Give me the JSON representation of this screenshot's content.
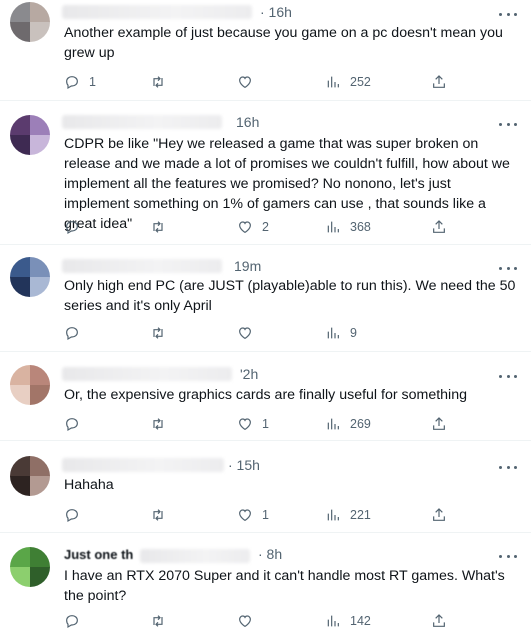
{
  "replies": [
    {
      "time": "· 16h",
      "text": "Another example of just because you game on a pc doesn't mean you grew up",
      "reply_count": "1",
      "retweet_count": "",
      "like_count": "",
      "view_count": "252",
      "avatar_colors": [
        "#8a8a8e",
        "#b7a9a2",
        "#6e6a6d",
        "#c9c1bd"
      ]
    },
    {
      "time": "16h",
      "text": "CDPR be like \"Hey we released a game that was super broken on release and we made a lot of promises we couldn't fulfill, how about we implement all the features we promised? No nonono, let's just implement something on 1% of gamers can use , that sounds like a great idea\"",
      "reply_count": "",
      "retweet_count": "",
      "like_count": "2",
      "view_count": "368",
      "avatar_colors": [
        "#5b3b6e",
        "#9c7fb8",
        "#3e2a52",
        "#c8b6da"
      ]
    },
    {
      "time": "19m",
      "text": "Only high end PC (are JUST (playable)able to run this). We need the 50 series and it's only April",
      "reply_count": "",
      "retweet_count": "",
      "like_count": "",
      "view_count": "9",
      "avatar_colors": [
        "#3b5a8c",
        "#7a90b8",
        "#22345a",
        "#a9b8d4"
      ]
    },
    {
      "time": "'2h",
      "text": "Or, the expensive graphics cards are finally useful for something",
      "reply_count": "",
      "retweet_count": "",
      "like_count": "1",
      "view_count": "269",
      "avatar_colors": [
        "#d9b3a1",
        "#b9867a",
        "#e8cfc3",
        "#a27568"
      ]
    },
    {
      "time": "· 15h",
      "text": "Hahaha",
      "reply_count": "",
      "retweet_count": "",
      "like_count": "1",
      "view_count": "221",
      "avatar_colors": [
        "#4a3a36",
        "#8f6f66",
        "#2d2321",
        "#b39a92"
      ]
    },
    {
      "time": "· 8h",
      "name_partial": "Just one th",
      "text": "I have an RTX 2070 Super and it can't handle most RT games.  What's the point?",
      "reply_count": "",
      "retweet_count": "",
      "like_count": "",
      "view_count": "142",
      "avatar_colors": [
        "#5aa648",
        "#3f7f34",
        "#8ccf6e",
        "#2f5f2a"
      ]
    }
  ],
  "icons": {
    "reply": "reply-bubble-icon",
    "retweet": "retweet-icon",
    "like": "heart-icon",
    "views": "views-bar-chart-icon",
    "share": "share-upload-icon",
    "more": "more-dots-icon"
  }
}
